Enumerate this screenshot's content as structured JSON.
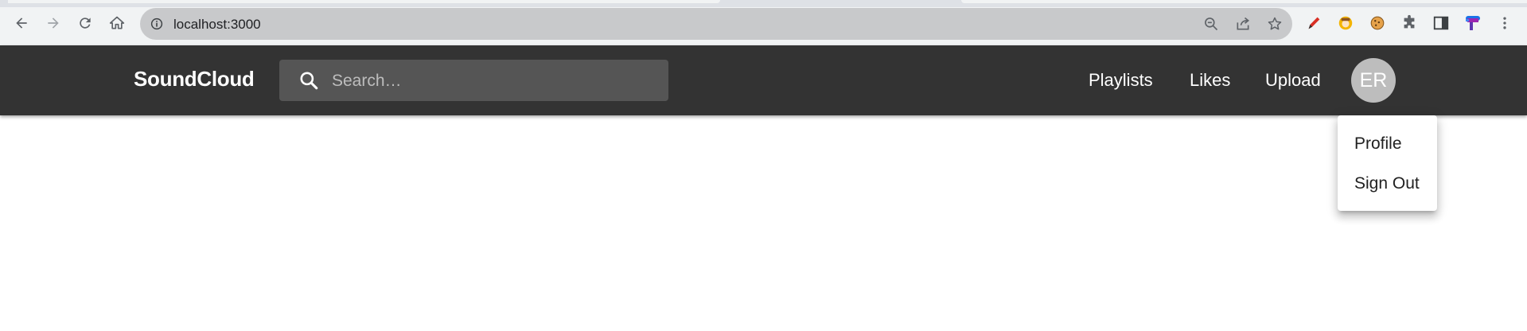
{
  "browser": {
    "url": "localhost:3000"
  },
  "appbar": {
    "brand": "SoundCloud",
    "search": {
      "placeholder": "Search…",
      "value": ""
    },
    "nav": {
      "playlists": "Playlists",
      "likes": "Likes",
      "upload": "Upload"
    },
    "avatar_initials": "ER"
  },
  "user_menu": {
    "items": [
      "Profile",
      "Sign Out"
    ]
  },
  "colors": {
    "appbar_bg": "#333333",
    "search_bg": "#555555",
    "avatar_bg": "#bdbdbd"
  }
}
